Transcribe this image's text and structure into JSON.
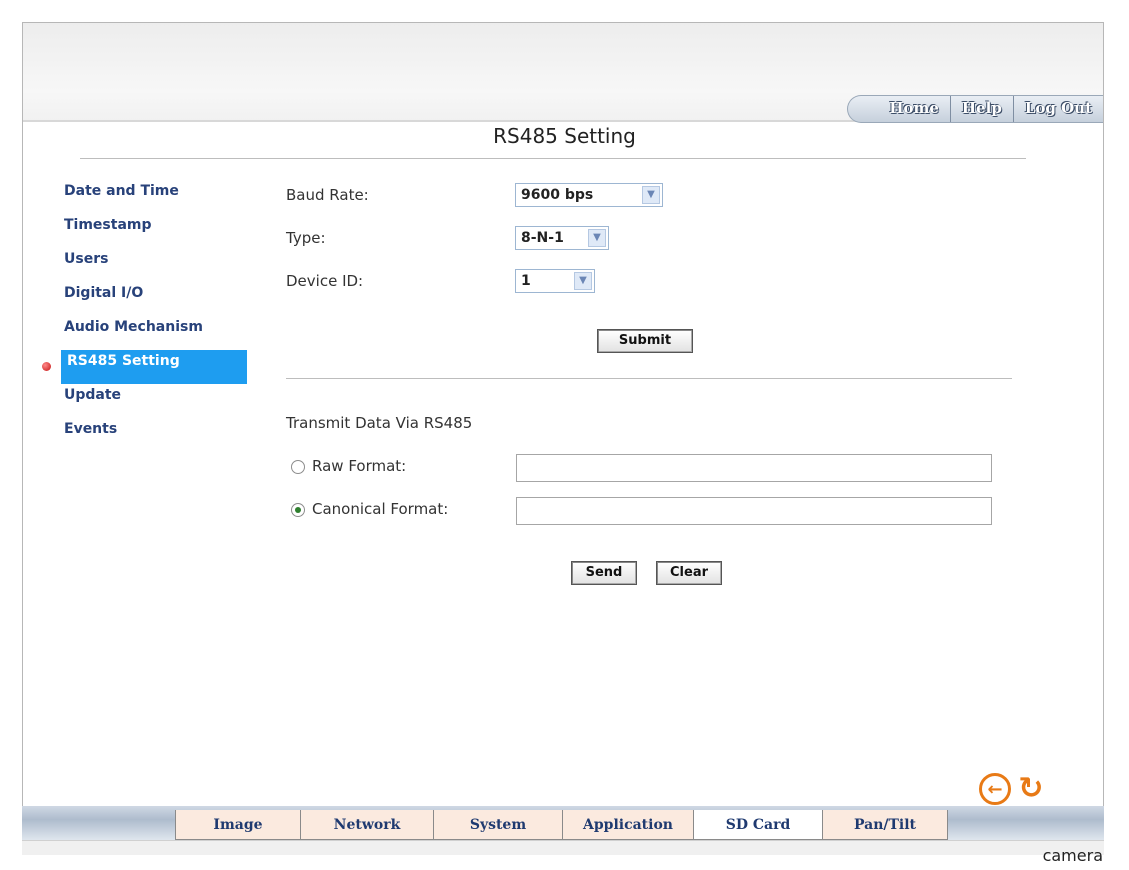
{
  "top_nav": {
    "home": "Home",
    "help": "Help",
    "logout": "Log Out"
  },
  "page_title": "RS485 Setting",
  "sidebar": {
    "items": [
      {
        "label": "Date and Time"
      },
      {
        "label": "Timestamp"
      },
      {
        "label": "Users"
      },
      {
        "label": "Digital I/O"
      },
      {
        "label": "Audio Mechanism"
      },
      {
        "label": "RS485 Setting",
        "active": true
      },
      {
        "label": "Update"
      },
      {
        "label": "Events"
      }
    ]
  },
  "settings": {
    "baud_rate_label": "Baud Rate:",
    "baud_rate_value": "9600 bps",
    "type_label": "Type:",
    "type_value": "8-N-1",
    "device_id_label": "Device ID:",
    "device_id_value": "1",
    "submit_label": "Submit"
  },
  "transmit": {
    "heading": "Transmit Data Via RS485",
    "raw_label": "Raw Format:",
    "raw_value": "",
    "canonical_label": "Canonical Format:",
    "canonical_value": "",
    "selected": "canonical",
    "send_label": "Send",
    "clear_label": "Clear"
  },
  "icons": {
    "back": "back-arrow-icon",
    "refresh": "refresh-icon"
  },
  "bottom_tabs": [
    "Image",
    "Network",
    "System",
    "Application",
    "SD Card",
    "Pan/Tilt"
  ],
  "brand": "camera",
  "colors": {
    "active_item": "#1e9df0",
    "link": "#28427a",
    "icon_accent": "#e87a16"
  }
}
